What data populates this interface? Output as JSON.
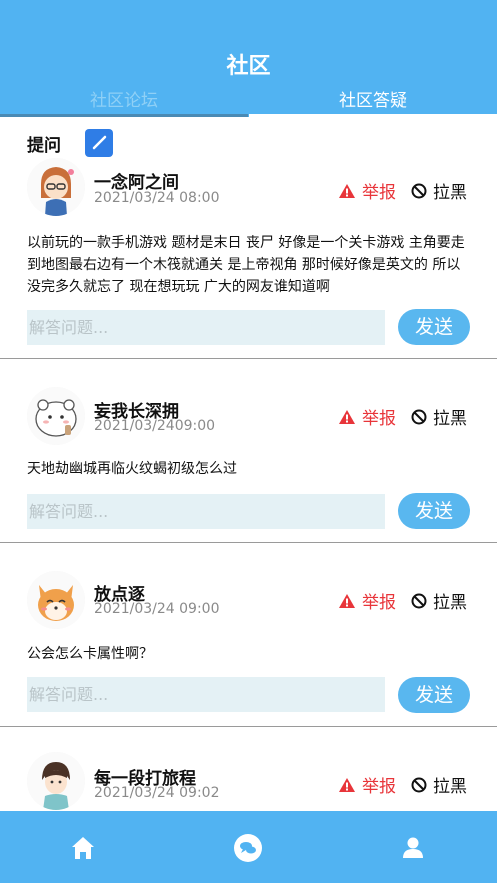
{
  "header": {
    "title": "社区",
    "tabs": [
      {
        "label": "社区论坛",
        "active": false
      },
      {
        "label": "社区答疑",
        "active": true
      }
    ]
  },
  "ask": {
    "label": "提问",
    "icon": "edit-icon"
  },
  "posts": [
    {
      "username": "一念阿之间",
      "date": "2021/03/24 08:00",
      "content": "以前玩的一款手机游戏 题材是末日 丧尸 好像是一个关卡游戏 主角要走到地图最右边有一个木筏就通关 是上帝视角 那时候好像是英文的 所以没完多久就忘了 现在想玩玩 广大的网友谁知道啊",
      "report_label": "举报",
      "block_label": "拉黑",
      "answer_placeholder": "解答问题...",
      "send_label": "发送"
    },
    {
      "username": "妄我长深拥",
      "date": "2021/03/2409:00",
      "content": "天地劫幽城再临火纹蝎初级怎么过",
      "report_label": "举报",
      "block_label": "拉黑",
      "answer_placeholder": "解答问题...",
      "send_label": "发送"
    },
    {
      "username": "放点逐",
      "date": "2021/03/24 09:00",
      "content": "公会怎么卡属性啊？",
      "report_label": "举报",
      "block_label": "拉黑",
      "answer_placeholder": "解答问题...",
      "send_label": "发送"
    },
    {
      "username": "每一段打旅程",
      "date": "2021/03/24 09:02",
      "report_label": "举报",
      "block_label": "拉黑"
    }
  ],
  "bottom_nav": [
    {
      "icon": "home-icon"
    },
    {
      "icon": "chat-icon"
    },
    {
      "icon": "user-icon"
    }
  ],
  "colors": {
    "primary": "#51B3F2",
    "report": "#e8353a",
    "input_bg": "#e4f1f5"
  }
}
